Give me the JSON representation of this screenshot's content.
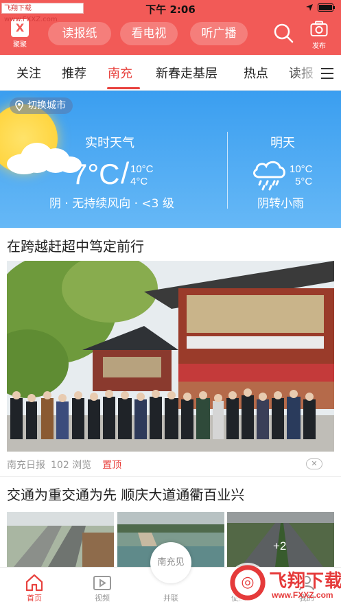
{
  "watermark": {
    "top_left": "飞翔下载 www.FXXZ.com",
    "brand": "飞翔下载",
    "url": "www.FXXZ.com"
  },
  "status_bar": {
    "time": "下午 2:06"
  },
  "header": {
    "app_label": "聚聚",
    "app_icon": "person-logo-icon",
    "pills": [
      "读报纸",
      "看电视",
      "听广播"
    ],
    "search_icon": "search-icon",
    "publish_label": "发布",
    "accent": "#f25a57"
  },
  "tabs": {
    "items": [
      "关注",
      "推荐",
      "南充",
      "新春走基层",
      "热点",
      "读报"
    ],
    "active": "南充",
    "active_color": "#e8413d"
  },
  "weather": {
    "switch_city": "切换城市",
    "now": {
      "label": "实时天气",
      "temp": "7°C",
      "slash": "/",
      "high": "10°C",
      "low": "4°C",
      "desc": "阴 · 无持续风向 · <3 级"
    },
    "tomorrow": {
      "label": "明天",
      "high": "10°C",
      "low": "5°C",
      "desc": "阴转小雨",
      "icon": "rain-cloud-icon"
    }
  },
  "articles": [
    {
      "title": "在跨越赶超中笃定前行",
      "source": "南充日报",
      "views": "102 浏览",
      "pinned": "置顶",
      "close": "✕"
    },
    {
      "title": "交通为重交通为先 顺庆大道通衢百业兴",
      "more_count": "+2"
    }
  ],
  "center_badge": "南充见",
  "bottom_nav": [
    {
      "label": "首页",
      "icon": "home-icon",
      "active": true
    },
    {
      "label": "视频",
      "icon": "video-icon",
      "active": false
    },
    {
      "label": "并联",
      "icon": "center-badge",
      "active": false
    },
    {
      "label": "便民",
      "icon": "people-icon",
      "active": false
    },
    {
      "label": "我的",
      "icon": "user-icon",
      "active": false
    }
  ]
}
